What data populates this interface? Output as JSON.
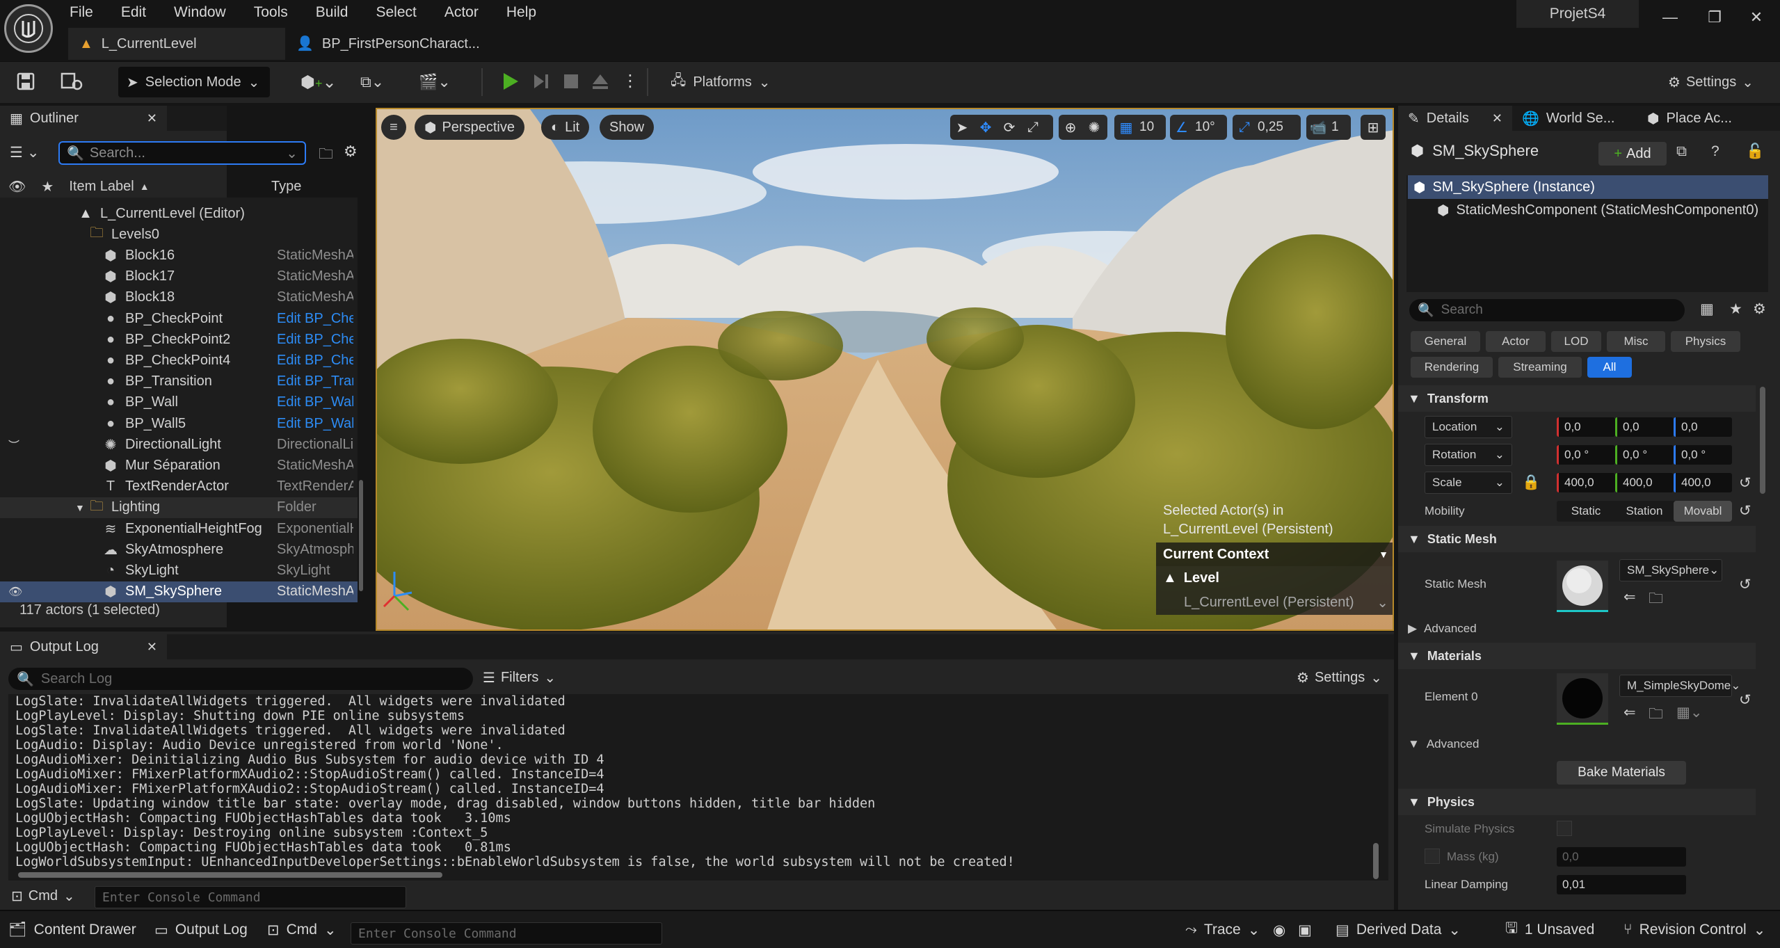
{
  "menu": [
    "File",
    "Edit",
    "Window",
    "Tools",
    "Build",
    "Select",
    "Actor",
    "Help"
  ],
  "project_name": "ProjetS4",
  "doc_tabs": [
    {
      "label": "L_CurrentLevel",
      "active": true
    },
    {
      "label": "BP_FirstPersonCharact..."
    }
  ],
  "toolbar": {
    "selection_mode": "Selection Mode",
    "platforms": "Platforms",
    "settings": "Settings"
  },
  "outliner": {
    "tab_label": "Outliner",
    "search_placeholder": "Search...",
    "col_label": "Item Label",
    "col_type": "Type",
    "rows": [
      {
        "label": "L_CurrentLevel (Editor)",
        "type": "",
        "icon": "level-icon",
        "indent": 0
      },
      {
        "label": "Levels0",
        "type": "",
        "icon": "folder-icon",
        "indent": 1
      },
      {
        "label": "Block16",
        "type": "StaticMeshA",
        "icon": "static-mesh-icon",
        "indent": 2
      },
      {
        "label": "Block17",
        "type": "StaticMeshA",
        "icon": "static-mesh-icon",
        "indent": 2
      },
      {
        "label": "Block18",
        "type": "StaticMeshA",
        "icon": "static-mesh-icon",
        "indent": 2
      },
      {
        "label": "BP_CheckPoint",
        "type": "Edit BP_Che",
        "link": true,
        "icon": "blueprint-icon",
        "indent": 2
      },
      {
        "label": "BP_CheckPoint2",
        "type": "Edit BP_Che",
        "link": true,
        "icon": "blueprint-icon",
        "indent": 2
      },
      {
        "label": "BP_CheckPoint4",
        "type": "Edit BP_Che",
        "link": true,
        "icon": "blueprint-icon",
        "indent": 2
      },
      {
        "label": "BP_Transition",
        "type": "Edit BP_Trar",
        "link": true,
        "icon": "blueprint-icon",
        "indent": 2
      },
      {
        "label": "BP_Wall",
        "type": "Edit BP_Wall",
        "link": true,
        "icon": "blueprint-icon",
        "indent": 2
      },
      {
        "label": "BP_Wall5",
        "type": "Edit BP_Wall",
        "link": true,
        "icon": "blueprint-icon",
        "indent": 2
      },
      {
        "label": "DirectionalLight",
        "type": "DirectionalLi",
        "icon": "sun-icon",
        "indent": 2,
        "hidden_eye": true
      },
      {
        "label": "Mur Séparation",
        "type": "StaticMeshA",
        "icon": "static-mesh-icon",
        "indent": 2
      },
      {
        "label": "TextRenderActor",
        "type": "TextRenderA",
        "icon": "text-icon",
        "indent": 2
      },
      {
        "label": "Lighting",
        "type": "Folder",
        "icon": "folder-icon",
        "indent": 1
      },
      {
        "label": "ExponentialHeightFog",
        "type": "ExponentialH",
        "icon": "fog-icon",
        "indent": 2
      },
      {
        "label": "SkyAtmosphere",
        "type": "SkyAtmosph",
        "icon": "sky-icon",
        "indent": 2
      },
      {
        "label": "SkyLight",
        "type": "SkyLight",
        "icon": "skylight-icon",
        "indent": 2
      },
      {
        "label": "SM_SkySphere",
        "type": "StaticMeshA",
        "icon": "static-mesh-icon",
        "indent": 2,
        "selected": true
      }
    ],
    "status": "117 actors (1 selected)"
  },
  "viewport": {
    "perspective": "Perspective",
    "lit": "Lit",
    "show": "Show",
    "grid_snap": "10",
    "rot_snap": "10°",
    "scale_snap": "0,25",
    "camera_speed": "1",
    "context_selected": "Selected Actor(s) in",
    "context_level_name": "L_CurrentLevel (Persistent)",
    "context_title": "Current Context",
    "context_level": "Level",
    "context_level_value": "L_CurrentLevel (Persistent)"
  },
  "output_log": {
    "tab_label": "Output Log",
    "search_placeholder": "Search Log",
    "filters": "Filters",
    "settings": "Settings",
    "lines": [
      "LogSlate: InvalidateAllWidgets triggered.  All widgets were invalidated",
      "LogPlayLevel: Display: Shutting down PIE online subsystems",
      "LogSlate: InvalidateAllWidgets triggered.  All widgets were invalidated",
      "LogAudio: Display: Audio Device unregistered from world 'None'.",
      "LogAudioMixer: Deinitializing Audio Bus Subsystem for audio device with ID 4",
      "LogAudioMixer: FMixerPlatformXAudio2::StopAudioStream() called. InstanceID=4",
      "LogAudioMixer: FMixerPlatformXAudio2::StopAudioStream() called. InstanceID=4",
      "LogSlate: Updating window title bar state: overlay mode, drag disabled, window buttons hidden, title bar hidden",
      "LogUObjectHash: Compacting FUObjectHashTables data took   3.10ms",
      "LogPlayLevel: Display: Destroying online subsystem :Context_5",
      "LogUObjectHash: Compacting FUObjectHashTables data took   0.81ms",
      "LogWorldSubsystemInput: UEnhancedInputDeveloperSettings::bEnableWorldSubsystem is false, the world subsystem will not be created!"
    ],
    "cmd_label": "Cmd",
    "console_placeholder": "Enter Console Command"
  },
  "details": {
    "tabs": [
      "Details",
      "World Se...",
      "Place Ac..."
    ],
    "actor_name": "SM_SkySphere",
    "add_label": "Add",
    "components": [
      "SM_SkySphere (Instance)",
      "StaticMeshComponent (StaticMeshComponent0)"
    ],
    "search_placeholder": "Search",
    "categories": [
      "General",
      "Actor",
      "LOD",
      "Misc",
      "Physics",
      "Rendering",
      "Streaming",
      "All"
    ],
    "transform": {
      "title": "Transform",
      "location_label": "Location",
      "location": [
        "0,0",
        "0,0",
        "0,0"
      ],
      "rotation_label": "Rotation",
      "rotation": [
        "0,0 °",
        "0,0 °",
        "0,0 °"
      ],
      "scale_label": "Scale",
      "scale": [
        "400,0",
        "400,0",
        "400,0"
      ],
      "mobility_label": "Mobility",
      "mobility_options": [
        "Static",
        "Station",
        "Movabl"
      ]
    },
    "static_mesh": {
      "title": "Static Mesh",
      "label": "Static Mesh",
      "value": "SM_SkySphere"
    },
    "advanced": "Advanced",
    "materials": {
      "title": "Materials",
      "element_label": "Element 0",
      "value": "M_SimpleSkyDome"
    },
    "advanced2": "Advanced",
    "bake_materials": "Bake Materials",
    "physics": {
      "title": "Physics",
      "simulate_label": "Simulate Physics",
      "mass_label": "Mass (kg)",
      "mass_value": "0,0",
      "linear_damping_label": "Linear Damping",
      "linear_damping_value": "0,01"
    }
  },
  "statusbar": {
    "content_drawer": "Content Drawer",
    "output_log": "Output Log",
    "cmd": "Cmd",
    "console_placeholder": "Enter Console Command",
    "trace": "Trace",
    "derived_data": "Derived Data",
    "unsaved": "1 Unsaved",
    "revision_control": "Revision Control"
  },
  "colors": {
    "accent_blue": "#2d7bf5",
    "play_green": "#4caf22",
    "selection_bg": "#3b4e71"
  }
}
